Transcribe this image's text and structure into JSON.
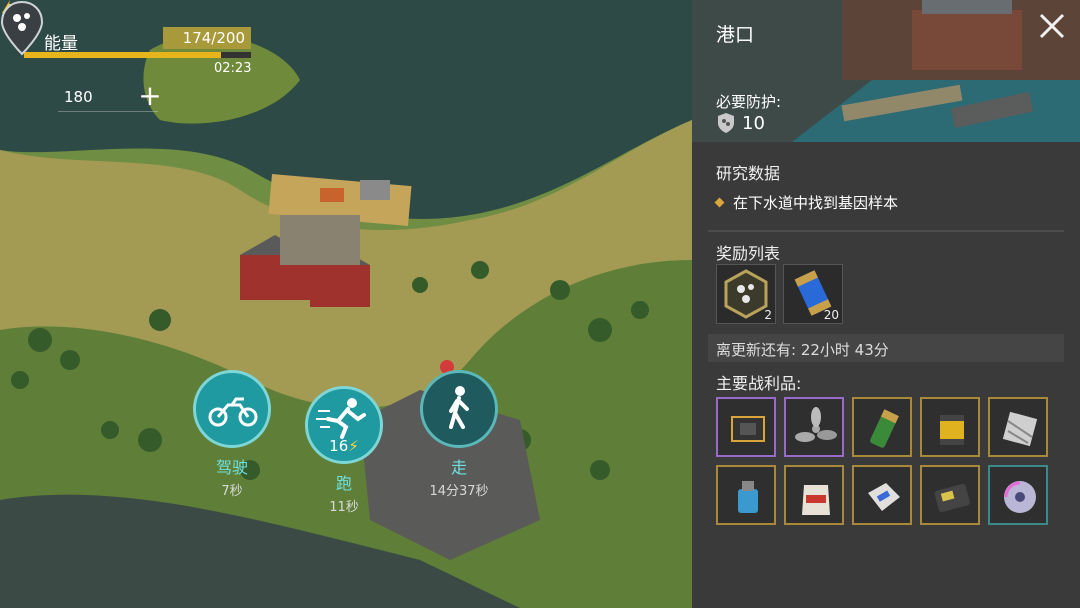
{
  "hud": {
    "energy_label": "能量",
    "energy_value": "174/200",
    "energy_fraction": 0.87,
    "energy_timer": "02:23",
    "crate_count": "180"
  },
  "travel": {
    "drive": {
      "label": "驾驶",
      "time": "7秒"
    },
    "run": {
      "label": "跑",
      "time": "11秒",
      "energy_cost": "16"
    },
    "walk": {
      "label": "走",
      "time": "14分37秒"
    }
  },
  "panel": {
    "title": "港口",
    "protection_label": "必要防护:",
    "protection_value": "10",
    "research_title": "研究数据",
    "research_task": "在下水道中找到基因样本",
    "rewards_title": "奖励列表",
    "rewards": [
      {
        "icon": "virus-hex-icon",
        "count": "2"
      },
      {
        "icon": "energy-canister-icon",
        "count": "20"
      }
    ],
    "refresh_text": "离更新还有: 22小时 43分",
    "loot_title": "主要战利品:",
    "loot": [
      {
        "icon": "circuit-board-icon",
        "rarity": "#9a6ac8"
      },
      {
        "icon": "propeller-icon",
        "rarity": "#9a6ac8"
      },
      {
        "icon": "battery-icon",
        "rarity": "#a8893a"
      },
      {
        "icon": "oil-filter-icon",
        "rarity": "#a8893a"
      },
      {
        "icon": "duct-tape-icon",
        "rarity": "#a8893a"
      },
      {
        "icon": "water-pump-icon",
        "rarity": "#a8893a"
      },
      {
        "icon": "chemical-sack-icon",
        "rarity": "#a8893a"
      },
      {
        "icon": "cement-bag-icon",
        "rarity": "#a8893a"
      },
      {
        "icon": "electronic-device-icon",
        "rarity": "#a8893a"
      },
      {
        "icon": "compact-disc-icon",
        "rarity": "#3a8a8a"
      }
    ]
  }
}
